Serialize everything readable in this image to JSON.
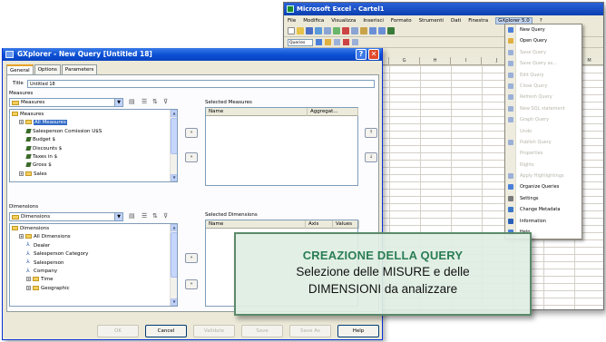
{
  "excel": {
    "title": "Microsoft Excel - Cartel1",
    "menus": [
      "File",
      "Modifica",
      "Visualizza",
      "Inserisci",
      "Formato",
      "Strumenti",
      "Dati",
      "Finestra",
      "GXplorer 5.0",
      "?"
    ],
    "active_menu": "GXplorer 5.0",
    "toolbar_label": "Queries",
    "columns": [
      "D",
      "E",
      "F",
      "G",
      "H",
      "I",
      "J",
      "K",
      "L",
      "M"
    ],
    "menu_items": [
      {
        "label": "New Query",
        "enabled": true,
        "color": "#4a7fd8"
      },
      {
        "label": "Open Query",
        "enabled": true,
        "color": "#e0b040"
      },
      {
        "label": "Save Query",
        "enabled": false,
        "color": "#9bb0d8"
      },
      {
        "label": "Save Query as...",
        "enabled": false,
        "color": "#9bb0d8"
      },
      {
        "label": "Edit Query",
        "enabled": false,
        "color": "#9bb0d8"
      },
      {
        "label": "Close Query",
        "enabled": false,
        "color": "#9bb0d8"
      },
      {
        "label": "Refresh Query",
        "enabled": false,
        "color": "#9bb0d8"
      },
      {
        "label": "New SQL statement",
        "enabled": false,
        "color": "#9bb0d8"
      },
      {
        "label": "Graph Query",
        "enabled": false,
        "color": "#9bb0d8"
      },
      {
        "label": "Undo",
        "enabled": false,
        "color": ""
      },
      {
        "label": "Publish Query",
        "enabled": false,
        "color": "#9bb0d8"
      },
      {
        "label": "Properties",
        "enabled": false,
        "color": ""
      },
      {
        "label": "Rights",
        "enabled": false,
        "color": ""
      },
      {
        "label": "Apply Highlightings",
        "enabled": false,
        "color": "#9bb0d8"
      },
      {
        "label": "Organize Queries",
        "enabled": true,
        "color": "#4a7fd8"
      },
      {
        "label": "Settings",
        "enabled": true,
        "color": "#7a7a7a"
      },
      {
        "label": "Change Metadata",
        "enabled": true,
        "color": "#3b78c9"
      },
      {
        "label": "Information",
        "enabled": true,
        "color": "#2a5fb8"
      },
      {
        "label": "Help",
        "enabled": true,
        "color": "#4a7fd8"
      }
    ]
  },
  "dialog": {
    "title": "GXplorer - New Query [Untitled 18]",
    "tabs": [
      "General",
      "Options",
      "Parameters"
    ],
    "title_label": "Title",
    "title_value": "Untitled 18",
    "measures_label": "Measures",
    "measures_combo": "Measures",
    "measures_tree": [
      {
        "label": "Measures",
        "type": "folder",
        "depth": 0
      },
      {
        "label": "All Measures",
        "type": "folder",
        "depth": 1,
        "selected": true
      },
      {
        "label": "Salesperson Comission U$S",
        "type": "measure",
        "depth": 2
      },
      {
        "label": "Budget $",
        "type": "measure",
        "depth": 2
      },
      {
        "label": "Discounts $",
        "type": "measure",
        "depth": 2
      },
      {
        "label": "Taxes in $",
        "type": "measure",
        "depth": 2
      },
      {
        "label": "Gross $",
        "type": "measure",
        "depth": 2
      },
      {
        "label": "Sales",
        "type": "folder",
        "depth": 1
      }
    ],
    "selected_measures_label": "Selected Measures",
    "selected_measures_cols": [
      "Name",
      "Aggregat..."
    ],
    "dimensions_label": "Dimensions",
    "dimensions_combo": "Dimensions",
    "dimensions_tree": [
      {
        "label": "Dimensions",
        "type": "folder",
        "depth": 0
      },
      {
        "label": "All Dimensions",
        "type": "folder",
        "depth": 1
      },
      {
        "label": "Dealer",
        "type": "dimension",
        "depth": 2
      },
      {
        "label": "Salesperson Category",
        "type": "dimension",
        "depth": 2
      },
      {
        "label": "Salesperson",
        "type": "dimension",
        "depth": 2
      },
      {
        "label": "Company",
        "type": "dimension",
        "depth": 2
      },
      {
        "label": "Time",
        "type": "folder",
        "depth": 2
      },
      {
        "label": "Geographic",
        "type": "folder",
        "depth": 2
      }
    ],
    "selected_dimensions_label": "Selected Dimensions",
    "selected_dimensions_cols": [
      "Name",
      "Axis",
      "Values"
    ],
    "buttons": [
      {
        "label": "OK",
        "enabled": false
      },
      {
        "label": "Cancel",
        "enabled": true
      },
      {
        "label": "Validate",
        "enabled": false
      },
      {
        "label": "Save",
        "enabled": false
      },
      {
        "label": "Save As",
        "enabled": false
      },
      {
        "label": "Help",
        "enabled": true
      }
    ]
  },
  "callout": {
    "heading": "CREAZIONE DELLA QUERY",
    "line1": "Selezione delle MISURE e delle",
    "line2": "DIMENSIONI da analizzare"
  },
  "colors": {
    "xp_title": "#0a4fd4",
    "callout_bg": "#e0eee3",
    "callout_border": "#5b8a6a",
    "callout_heading": "#2a7d55"
  }
}
